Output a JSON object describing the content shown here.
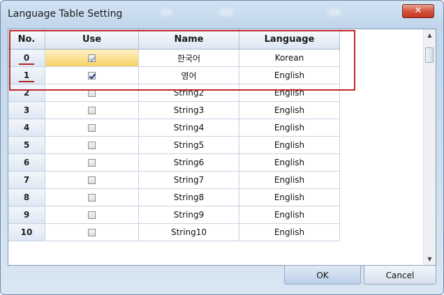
{
  "window": {
    "title": "Language Table Setting",
    "close_glyph": "✕",
    "accent_color": "#c1262d"
  },
  "grid": {
    "columns": [
      "No.",
      "Use",
      "Name",
      "Language"
    ],
    "rows": [
      {
        "no": "0",
        "use": true,
        "name": "한국어",
        "language": "Korean"
      },
      {
        "no": "1",
        "use": true,
        "name": "영어",
        "language": "English"
      },
      {
        "no": "2",
        "use": false,
        "name": "String2",
        "language": "English"
      },
      {
        "no": "3",
        "use": false,
        "name": "String3",
        "language": "English"
      },
      {
        "no": "4",
        "use": false,
        "name": "String4",
        "language": "English"
      },
      {
        "no": "5",
        "use": false,
        "name": "String5",
        "language": "English"
      },
      {
        "no": "6",
        "use": false,
        "name": "String6",
        "language": "English"
      },
      {
        "no": "7",
        "use": false,
        "name": "String7",
        "language": "English"
      },
      {
        "no": "8",
        "use": false,
        "name": "String8",
        "language": "English"
      },
      {
        "no": "9",
        "use": false,
        "name": "String9",
        "language": "English"
      },
      {
        "no": "10",
        "use": false,
        "name": "String10",
        "language": "English"
      }
    ]
  },
  "scrollbar": {
    "up_icon": "▲",
    "down_icon": "▼"
  },
  "buttons": {
    "ok": "OK",
    "cancel": "Cancel"
  }
}
